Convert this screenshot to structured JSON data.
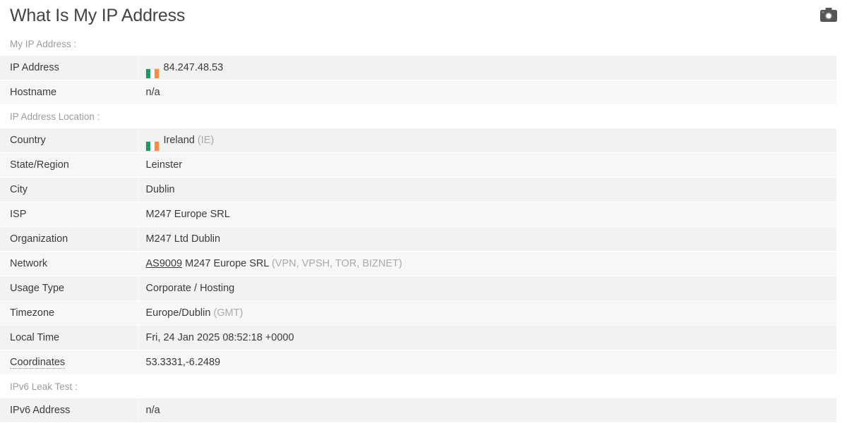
{
  "header": {
    "title": "What Is My IP Address",
    "snapshot_icon": "camera-icon"
  },
  "flag": {
    "country_code": "IE",
    "alt": "Ireland flag",
    "stripe_colors": [
      "#169b62",
      "#ffffff",
      "#ff883e"
    ]
  },
  "sections": [
    {
      "heading": "My IP Address :",
      "rows": [
        {
          "label": "IP Address",
          "value": "84.247.48.53",
          "flag": true
        },
        {
          "label": "Hostname",
          "value": "n/a"
        }
      ]
    },
    {
      "heading": "IP Address Location :",
      "rows": [
        {
          "label": "Country",
          "value": "Ireland",
          "suffix": "(IE)",
          "flag": true
        },
        {
          "label": "State/Region",
          "value": "Leinster"
        },
        {
          "label": "City",
          "value": "Dublin"
        },
        {
          "label": "ISP",
          "value": "M247 Europe SRL"
        },
        {
          "label": "Organization",
          "value": "M247 Ltd Dublin"
        },
        {
          "label": "Network",
          "link": "AS9009",
          "value": "M247 Europe SRL",
          "suffix": "(VPN, VPSH, TOR, BIZNET)"
        },
        {
          "label": "Usage Type",
          "value": "Corporate / Hosting"
        },
        {
          "label": "Timezone",
          "value": "Europe/Dublin",
          "suffix": "(GMT)"
        },
        {
          "label": "Local Time",
          "value": "Fri, 24 Jan 2025 08:52:18 +0000"
        },
        {
          "label": "Coordinates",
          "label_tooltip": true,
          "value": "53.3331,-6.2489"
        }
      ]
    },
    {
      "heading": "IPv6 Leak Test :",
      "rows": [
        {
          "label": "IPv6 Address",
          "value": "n/a"
        }
      ]
    }
  ]
}
